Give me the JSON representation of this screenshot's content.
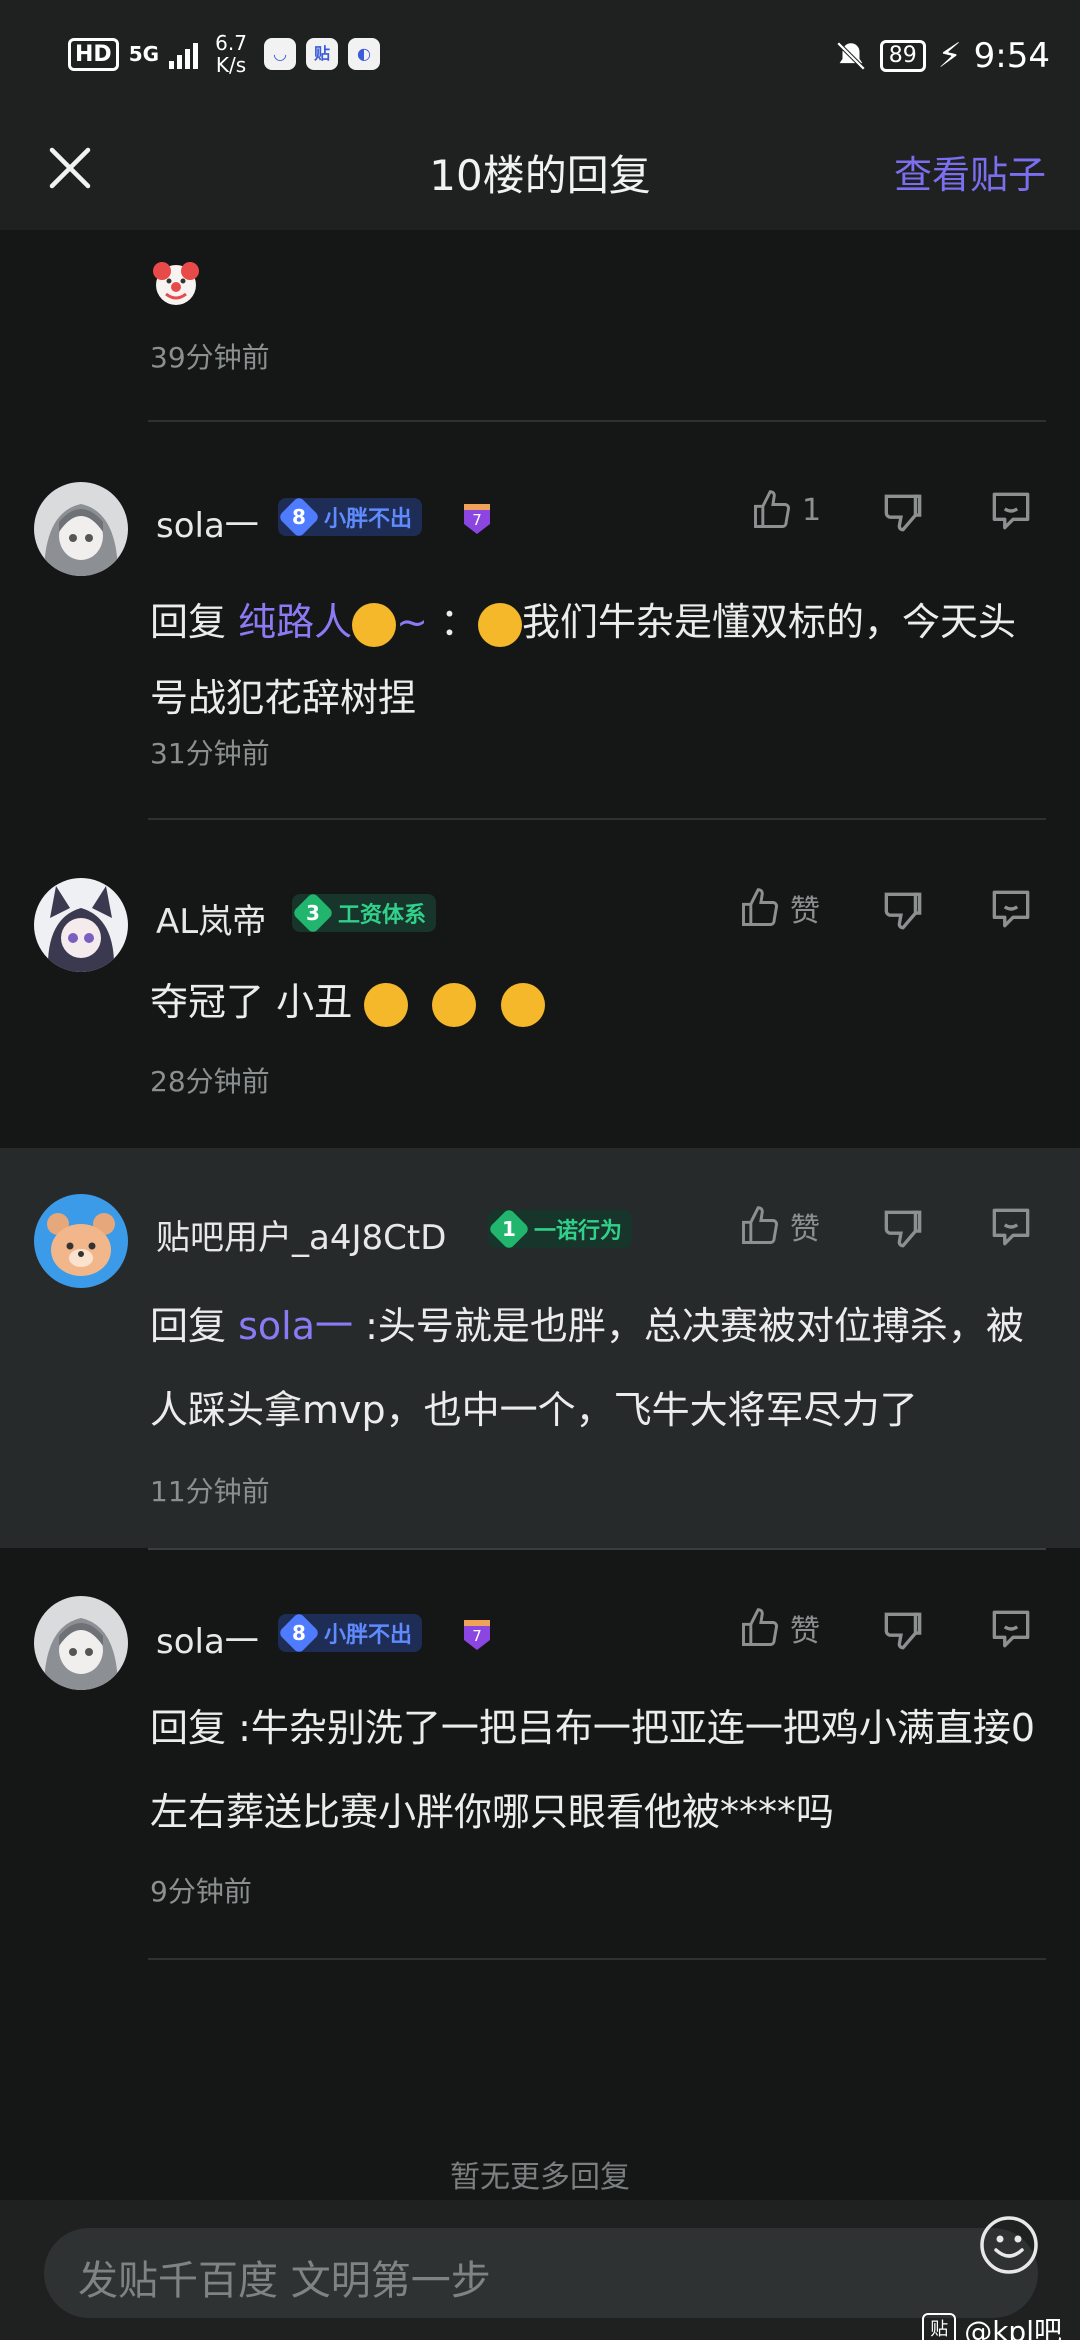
{
  "status_bar": {
    "hd": "HD",
    "network": "5G",
    "speed": "6.7\nK/s",
    "battery": "89",
    "time": "9:54"
  },
  "header": {
    "close_icon": "close-icon",
    "title": "10楼的回复",
    "action": "查看贴子"
  },
  "top_reply": {
    "time": "39分钟前"
  },
  "replies": [
    {
      "username": "sola一",
      "badge_level": "8",
      "badge_text": "小胖不出",
      "medal": "7",
      "like_label": "1",
      "content_prefix": "回复 ",
      "mention": "纯路人",
      "mention_suffix": "~ ",
      "content_body": "：",
      "content_rest": "我们牛杂是懂双标的，今天头号战犯花辞树捏",
      "time": "31分钟前"
    },
    {
      "username": "AL岚帝",
      "badge_level": "3",
      "badge_text": "工资体系",
      "like_label": "赞",
      "content_body": "夺冠了 小丑 ",
      "time": "28分钟前"
    },
    {
      "username": "贴吧用户_a4J8CtD",
      "badge_level": "1",
      "badge_text": "一诺行为",
      "like_label": "赞",
      "content_prefix": "回复 ",
      "mention": "sola一",
      "content_body": " :头号就是也胖，总决赛被对位搏杀，被人踩头拿mvp，也中一个，飞牛大将军尽力了",
      "time": "11分钟前"
    },
    {
      "username": "sola一",
      "badge_level": "8",
      "badge_text": "小胖不出",
      "medal": "7",
      "like_label": "赞",
      "content_body": "回复 :牛杂别洗了一把吕布一把亚连一把鸡小满直接0左右葬送比赛小胖你哪只眼看他被****吗",
      "time": "9分钟前"
    }
  ],
  "no_more": "暂无更多回复",
  "input": {
    "placeholder": "发贴千百度 文明第一步"
  },
  "watermark": {
    "logo": "贴",
    "text": "@kpl吧"
  },
  "colors": {
    "accent": "#7b6ff0",
    "background": "#141716",
    "badge_blue": "#4f7cff",
    "badge_green": "#22b56d"
  }
}
